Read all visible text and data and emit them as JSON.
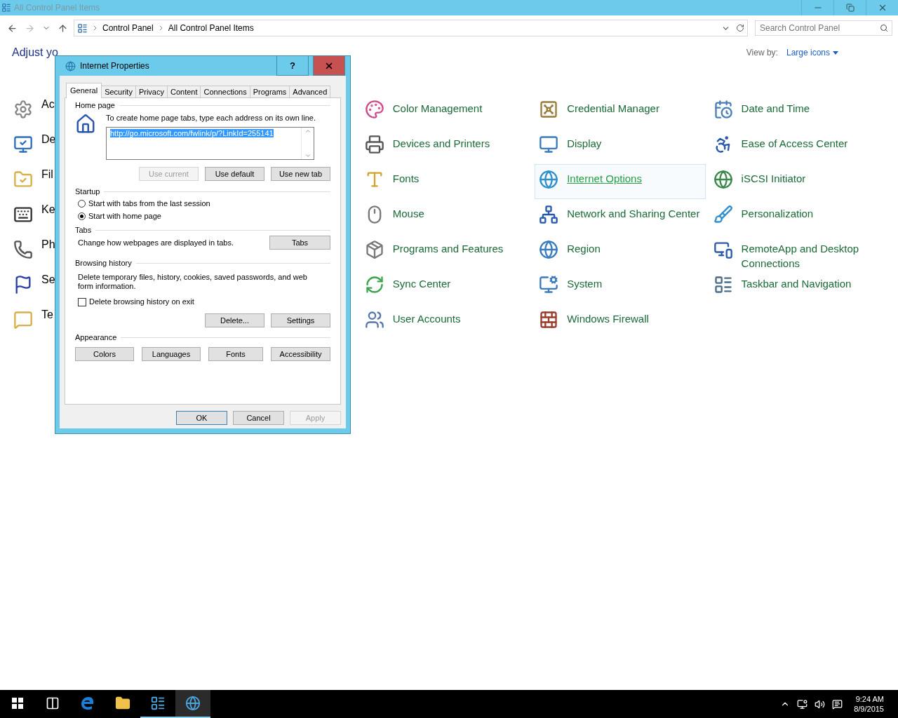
{
  "window": {
    "title": "All Control Panel Items",
    "active": false
  },
  "address_bar": {
    "path": [
      "Control Panel",
      "All Control Panel Items"
    ]
  },
  "search": {
    "placeholder": "Search Control Panel"
  },
  "heading": "Adjust yo",
  "view_by": {
    "label": "View by:",
    "value": "Large icons"
  },
  "left_column": [
    {
      "label": "Ac"
    },
    {
      "label": "De"
    },
    {
      "label": "Fil"
    },
    {
      "label": "Ke"
    },
    {
      "label": "Ph"
    },
    {
      "label": "Se"
    },
    {
      "label": "Te"
    }
  ],
  "columns": [
    [
      {
        "label": "Color Management",
        "highlighted": false
      },
      {
        "label": "Devices and Printers",
        "highlighted": false
      },
      {
        "label": "Fonts",
        "highlighted": false
      },
      {
        "label": "Mouse",
        "highlighted": false
      },
      {
        "label": "Programs and Features",
        "highlighted": false
      },
      {
        "label": "Sync Center",
        "highlighted": false
      },
      {
        "label": "User Accounts",
        "highlighted": false
      }
    ],
    [
      {
        "label": "Credential Manager",
        "highlighted": false
      },
      {
        "label": "Display",
        "highlighted": false
      },
      {
        "label": "Internet Options",
        "highlighted": true
      },
      {
        "label": "Network and Sharing Center",
        "highlighted": false
      },
      {
        "label": "Region",
        "highlighted": false
      },
      {
        "label": "System",
        "highlighted": false
      },
      {
        "label": "Windows Firewall",
        "highlighted": false
      }
    ],
    [
      {
        "label": "Date and Time",
        "highlighted": false
      },
      {
        "label": "Ease of Access Center",
        "highlighted": false
      },
      {
        "label": "iSCSI Initiator",
        "highlighted": false
      },
      {
        "label": "Personalization",
        "highlighted": false
      },
      {
        "label": "RemoteApp and Desktop Connections",
        "highlighted": false
      },
      {
        "label": "Taskbar and Navigation",
        "highlighted": false
      }
    ]
  ],
  "dialog": {
    "title": "Internet Properties",
    "help": "?",
    "tabs": [
      {
        "label": "General",
        "selected": true
      },
      {
        "label": "Security",
        "selected": false
      },
      {
        "label": "Privacy",
        "selected": false
      },
      {
        "label": "Content",
        "selected": false
      },
      {
        "label": "Connections",
        "selected": false
      },
      {
        "label": "Programs",
        "selected": false
      },
      {
        "label": "Advanced",
        "selected": false
      }
    ],
    "home_page": {
      "title": "Home page",
      "hint": "To create home page tabs, type each address on its own line.",
      "value": "http://go.microsoft.com/fwlink/p/?LinkId=255141",
      "value_selected": true,
      "buttons": [
        {
          "label": "Use current",
          "disabled": true
        },
        {
          "label": "Use default",
          "disabled": false
        },
        {
          "label": "Use new tab",
          "disabled": false
        }
      ]
    },
    "startup": {
      "title": "Startup",
      "options": [
        {
          "label": "Start with tabs from the last session",
          "selected": false
        },
        {
          "label": "Start with home page",
          "selected": true
        }
      ]
    },
    "tabs_section": {
      "title": "Tabs",
      "text": "Change how webpages are displayed in tabs.",
      "button": "Tabs"
    },
    "browsing_history": {
      "title": "Browsing history",
      "text": "Delete temporary files, history, cookies, saved passwords, and web form information.",
      "checkbox": {
        "label": "Delete browsing history on exit",
        "checked": false
      },
      "buttons": [
        "Delete...",
        "Settings"
      ]
    },
    "appearance": {
      "title": "Appearance",
      "buttons": [
        "Colors",
        "Languages",
        "Fonts",
        "Accessibility"
      ]
    },
    "footer": [
      {
        "label": "OK",
        "disabled": false,
        "default": true
      },
      {
        "label": "Cancel",
        "disabled": false,
        "default": false
      },
      {
        "label": "Apply",
        "disabled": true,
        "default": false
      }
    ]
  },
  "taskbar": {
    "apps": [
      {
        "kind": "start",
        "active": false
      },
      {
        "kind": "taskview",
        "active": false
      },
      {
        "kind": "edge",
        "active": false
      },
      {
        "kind": "explorer",
        "active": false
      },
      {
        "kind": "controlpanel",
        "active": true
      },
      {
        "kind": "internet",
        "active": true
      }
    ],
    "clock": {
      "time": "9:24 AM",
      "date": "8/9/2015"
    }
  }
}
